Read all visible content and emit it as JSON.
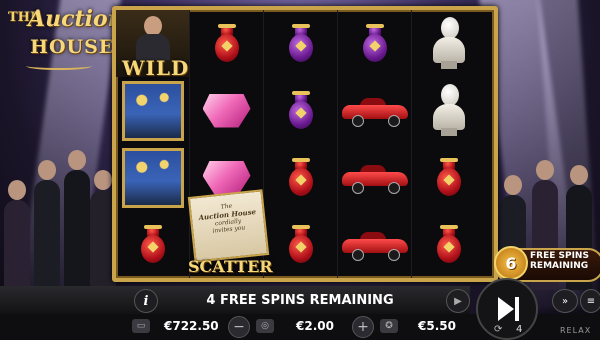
{
  "game": {
    "logo_the": "THE",
    "logo_auction": "Auction",
    "logo_house": "HOUSE"
  },
  "reels": {
    "wild_label": "WILD",
    "scatter_label": "SCATTER",
    "scatter_card_line1": "The",
    "scatter_card_line2": "Auction House",
    "scatter_card_line3": "cordially",
    "scatter_card_line4": "invites you",
    "columns": [
      [
        "wild",
        "painting",
        "painting",
        "vase-red"
      ],
      [
        "vase-red",
        "gem",
        "gem",
        "scatter"
      ],
      [
        "vase-purple",
        "vase-purple",
        "vase-red",
        "vase-red"
      ],
      [
        "vase-purple",
        "car",
        "car",
        "car"
      ],
      [
        "bust",
        "bust",
        "vase-red",
        "vase-red"
      ]
    ]
  },
  "free_spins": {
    "count": "6",
    "label": "FREE SPINS REMAINING"
  },
  "status_bar": {
    "message": "4 FREE SPINS REMAINING"
  },
  "controls": {
    "balance": "€722.50",
    "bet": "€2.00",
    "win": "€5.50",
    "autoplay_count": "4",
    "brand": "RELAX"
  },
  "colors": {
    "gold": "#c9a44a",
    "accent_gold_text": "#f6d77a"
  },
  "icons": [
    "info-icon",
    "next-icon",
    "spin-icon",
    "turbo-icon",
    "menu-icon",
    "wallet-icon",
    "coins-icon",
    "win-icon",
    "autoplay-icon"
  ]
}
